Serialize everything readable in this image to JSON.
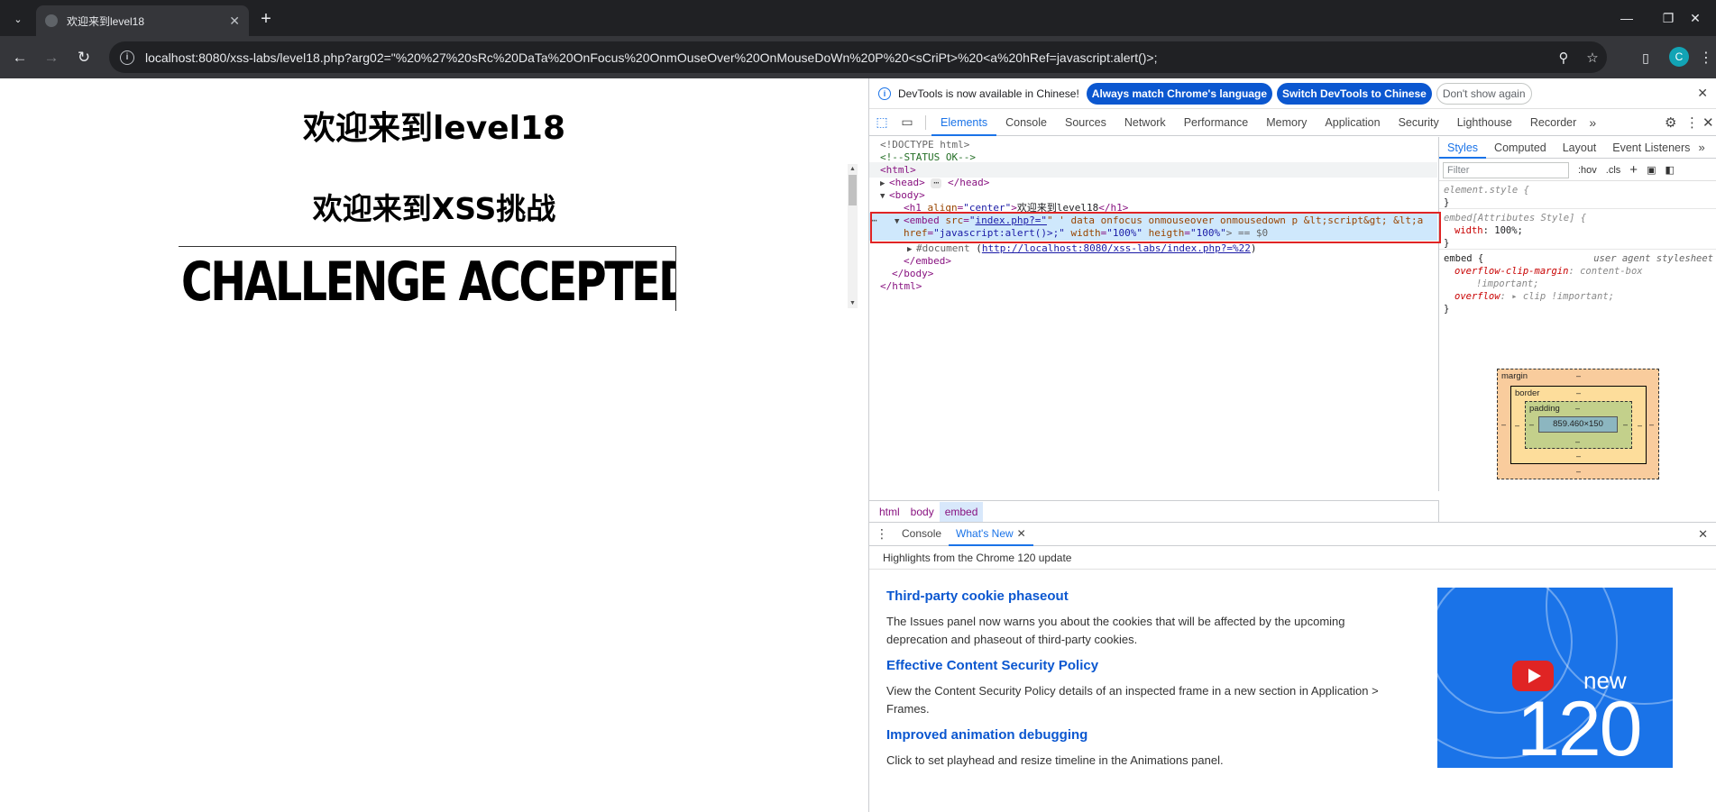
{
  "browser": {
    "tab_title": "欢迎来到level18",
    "url": "localhost:8080/xss-labs/level18.php?arg02=\"%20%27%20sRc%20DaTa%20OnFocus%20OnmOuseOver%20OnMouseDoWn%20P%20<sCriPt>%20<a%20hRef=javascript:alert()>;",
    "profile_initial": "C"
  },
  "page": {
    "heading1": "欢迎来到level18",
    "heading2": "欢迎来到XSS挑战",
    "image_text": "CHALLENGE ACCEPTED"
  },
  "devtools": {
    "infobar": {
      "message": "DevTools is now available in Chinese!",
      "btn_match": "Always match Chrome's language",
      "btn_switch": "Switch DevTools to Chinese",
      "btn_dont_show": "Don't show again"
    },
    "tabs": [
      "Elements",
      "Console",
      "Sources",
      "Network",
      "Performance",
      "Memory",
      "Application",
      "Security",
      "Lighthouse",
      "Recorder"
    ],
    "dom": {
      "doctype": "<!DOCTYPE html>",
      "comment": "<!--STATUS OK-->",
      "html_open": "<html>",
      "head_open": "<head>",
      "head_close": "</head>",
      "body_open": "<body>",
      "h1_open": "<h1 ",
      "h1_attr": "align",
      "h1_val": "\"center\"",
      "h1_text": "欢迎来到level18",
      "h1_close": "</h1>",
      "embed_tag": "<embed ",
      "embed_src_attr": "src",
      "embed_src_val": "index.php?=\"",
      "embed_rest1": "\" ' data onfocus onmouseover onmousedown p &lt;script&gt; &lt;a",
      "embed_href_attr": "href",
      "embed_href_val": "\"javascript:alert()>;\"",
      "embed_width_attr": "width",
      "embed_width_val": "\"100%\"",
      "embed_heigth_attr": "heigth",
      "embed_heigth_val": "\"100%\"",
      "embed_end": "> == $0",
      "document_label": "#document",
      "document_link": "http://localhost:8080/xss-labs/index.php?=%22",
      "embed_close": "</embed>",
      "body_close": "</body>",
      "html_close": "</html>"
    },
    "breadcrumbs": [
      "html",
      "body",
      "embed"
    ],
    "styles": {
      "tabs": [
        "Styles",
        "Computed",
        "Layout",
        "Event Listeners"
      ],
      "filter_placeholder": "Filter",
      "hov": ":hov",
      "cls": ".cls",
      "rule1_selector": "element.style {",
      "rule1_close": "}",
      "rule2_selector": "embed[Attributes Style] {",
      "rule2_prop": "width",
      "rule2_val": "100%;",
      "rule2_close": "}",
      "rule3_selector": "embed {",
      "rule3_source": "user agent stylesheet",
      "rule3_prop1": "overflow-clip-margin",
      "rule3_val1": "content-box",
      "rule3_val1b": "!important;",
      "rule3_prop2": "overflow",
      "rule3_val2": "clip !important;",
      "rule3_close": "}"
    },
    "box_model": {
      "margin_label": "margin",
      "border_label": "border",
      "padding_label": "padding",
      "content_size": "859.460×150",
      "dash": "–"
    },
    "drawer": {
      "tabs": [
        "Console",
        "What's New"
      ],
      "highlights": "Highlights from the Chrome 120 update",
      "items": [
        {
          "title": "Third-party cookie phaseout",
          "body": "The Issues panel now warns you about the cookies that will be affected by the upcoming deprecation and phaseout of third-party cookies."
        },
        {
          "title": "Effective Content Security Policy",
          "body": "View the Content Security Policy details of an inspected frame in a new section in Application > Frames."
        },
        {
          "title": "Improved animation debugging",
          "body": "Click to set playhead and resize timeline in the Animations panel."
        }
      ],
      "promo_new": "new",
      "promo_version": "120"
    }
  }
}
